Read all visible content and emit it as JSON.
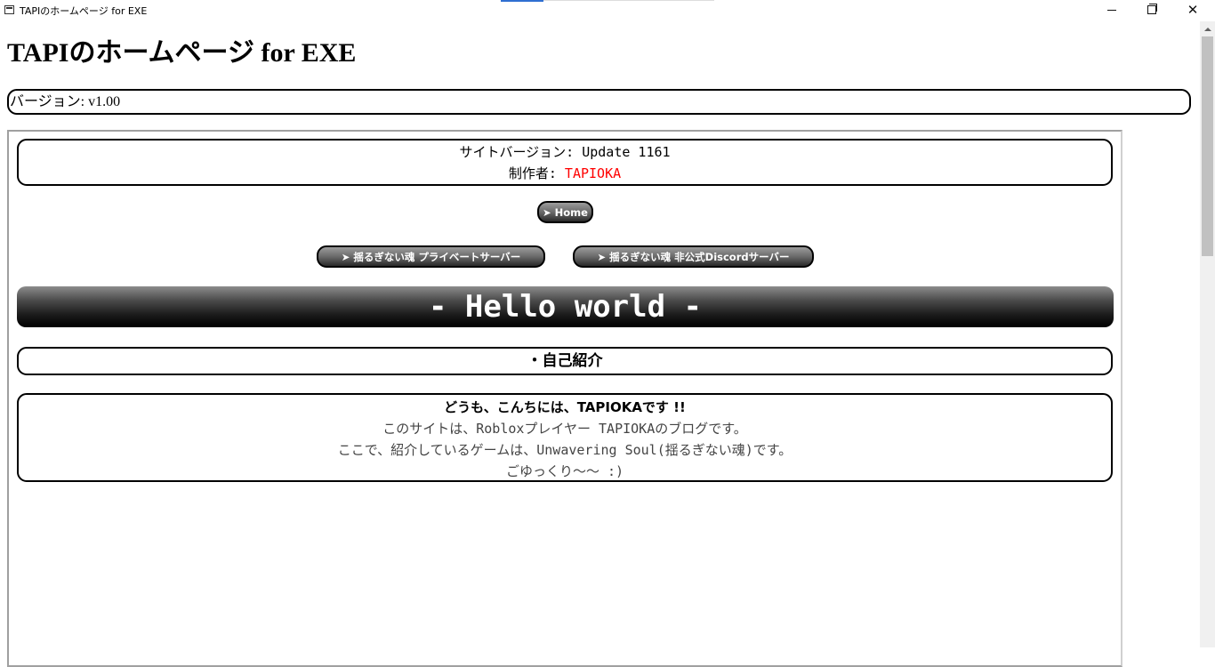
{
  "window": {
    "title": "TAPIのホームページ for EXE",
    "minimize_label": "─",
    "maximize_label": "",
    "close_label": "✕"
  },
  "page": {
    "title": "TAPIのホームページ for EXE",
    "version_text": "バージョン: v1.00"
  },
  "site": {
    "version_line": "サイトバージョン: Update 1161",
    "author_prefix": "制作者: ",
    "author_name": "TAPIOKA",
    "author_color": "#ff0000"
  },
  "nav": {
    "home": "➤ Home",
    "private_server": "➤ 揺るぎない魂 プライベートサーバー",
    "discord_server": "➤  揺るぎない魂 非公式Discordサーバー"
  },
  "banner": {
    "text": "- Hello world -"
  },
  "intro": {
    "heading": "・自己紹介",
    "greeting": "どうも、こんちには、TAPIOKAです !!",
    "line1": "このサイトは、Robloxプレイヤー TAPIOKAのブログです。",
    "line2": "ここで、紹介しているゲームは、Unwavering Soul(揺るぎない魂)です。",
    "line3": "ごゆっくり〜〜 :)"
  }
}
